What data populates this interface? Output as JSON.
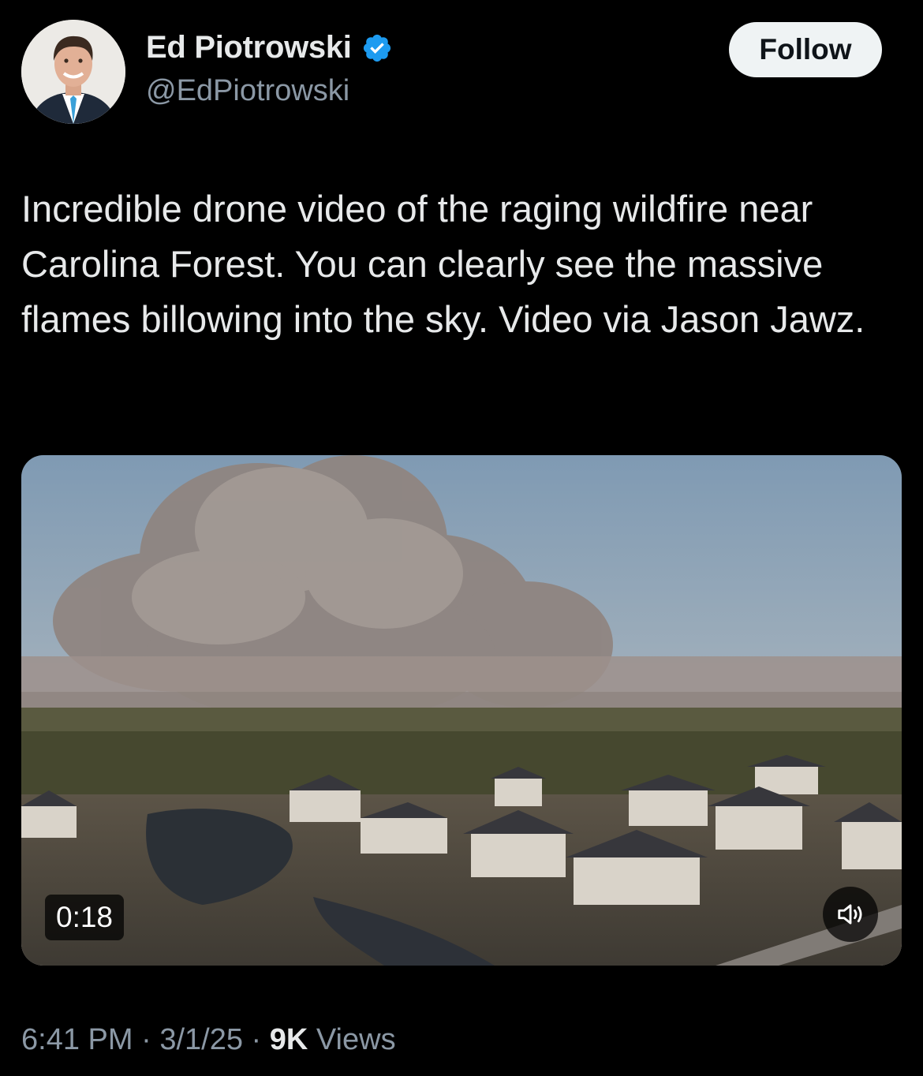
{
  "author": {
    "name": "Ed Piotrowski",
    "handle": "@EdPiotrowski",
    "verified": true,
    "verified_color": "#1d9bf0"
  },
  "follow_label": "Follow",
  "tweet_text": "Incredible drone video of the raging wildfire near Carolina Forest. You can clearly see the massive flames billowing into the sky. Video via Jason Jawz.",
  "video": {
    "duration": "0:18",
    "sound_icon": "speaker-icon"
  },
  "meta": {
    "time": "6:41 PM",
    "sep1": " · ",
    "date": "3/1/25",
    "sep2": " · ",
    "views_count": "9K",
    "views_label": " Views"
  },
  "colors": {
    "background": "#000000",
    "text": "#e7e9ea",
    "secondary_text": "#8b98a5",
    "follow_bg": "#eff3f4"
  }
}
